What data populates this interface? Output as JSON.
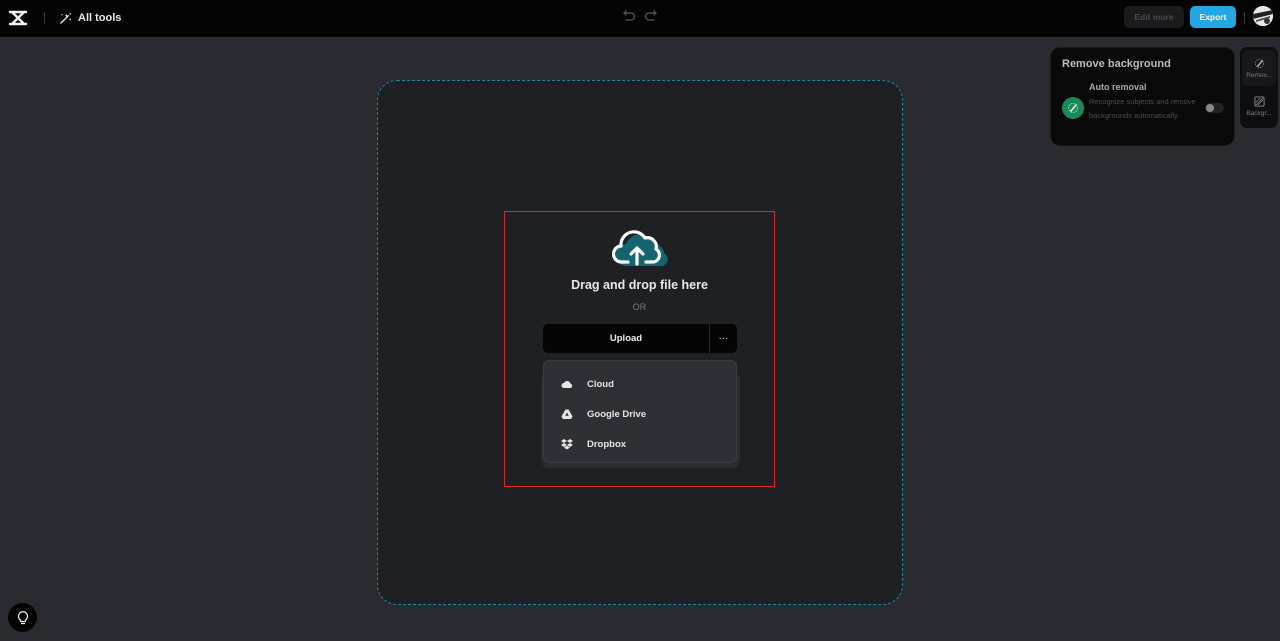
{
  "topbar": {
    "logo": "capcut-logo-icon",
    "all_tools_label": "All tools",
    "undo_icon": "undo-icon",
    "redo_icon": "redo-icon",
    "edit_more_label": "Edit more",
    "export_label": "Export",
    "avatar": "user-avatar"
  },
  "upload": {
    "drag_text": "Drag and drop file here",
    "or_text": "OR",
    "upload_label": "Upload",
    "more_label": "···",
    "menu": [
      {
        "label": "Cloud",
        "icon": "cloud-icon"
      },
      {
        "label": "Google Drive",
        "icon": "google-drive-icon"
      },
      {
        "label": "Dropbox",
        "icon": "dropbox-icon"
      }
    ]
  },
  "panel": {
    "title": "Remove background",
    "auto_removal_title": "Auto removal",
    "auto_removal_desc": "Recognize subjects and remove backgrounds automatically.",
    "toggle_on": false
  },
  "rail": [
    {
      "label": "Remov...",
      "icon": "remove-background-icon",
      "active": true
    },
    {
      "label": "Backgr...",
      "icon": "background-icon",
      "active": false
    }
  ],
  "colors": {
    "accent": "#22a7e2",
    "canvas_border": "#1a8a99",
    "dropzone_border": "#d9262c",
    "auto_icon_bg": "#1a8a5a"
  }
}
